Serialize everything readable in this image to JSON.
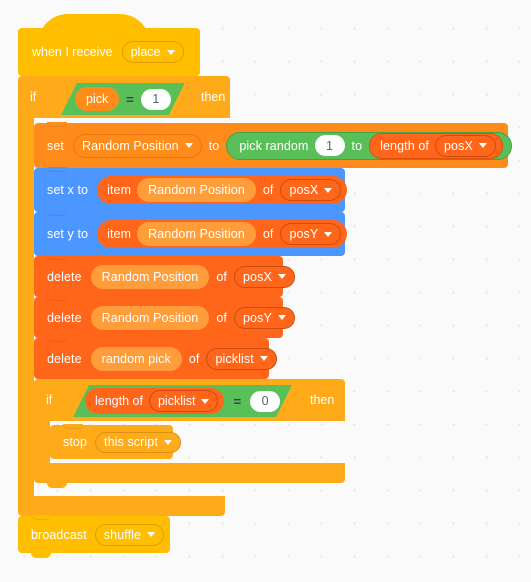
{
  "workspace": {
    "background_color": "#fafafa",
    "grid_dot_color": "#e3e3e3"
  },
  "palette": {
    "events": "#ffbf00",
    "control": "#ffab19",
    "motion": "#4c97ff",
    "variables": "#ff8c1a",
    "lists": "#ff661a",
    "operators": "#59c059",
    "input_text": "#575e75"
  },
  "script": {
    "hat": {
      "label": "when I receive",
      "dropdown_value": "place",
      "dropdown_icon": "chevron-down-icon"
    },
    "if_outer": {
      "label": "if",
      "then_label": "then",
      "condition": {
        "left_operand": "pick",
        "operator": "=",
        "right_operand": "1"
      }
    },
    "set_variable": {
      "label": "set",
      "variable": "Random Position",
      "to_label": "to",
      "dropdown_icon": "chevron-down-icon",
      "value": {
        "label": "pick random",
        "from": "1",
        "to_label": "to",
        "length_of_label": "length of",
        "list": "posX",
        "dropdown_icon": "chevron-down-icon"
      }
    },
    "set_x": {
      "label": "set x to",
      "item_label": "item",
      "index": "Random Position",
      "of_label": "of",
      "list": "posX",
      "dropdown_icon": "chevron-down-icon"
    },
    "set_y": {
      "label": "set y to",
      "item_label": "item",
      "index": "Random Position",
      "of_label": "of",
      "list": "posY",
      "dropdown_icon": "chevron-down-icon"
    },
    "delete_1": {
      "label": "delete",
      "index": "Random Position",
      "of_label": "of",
      "list": "posX",
      "dropdown_icon": "chevron-down-icon"
    },
    "delete_2": {
      "label": "delete",
      "index": "Random Position",
      "of_label": "of",
      "list": "posY",
      "dropdown_icon": "chevron-down-icon"
    },
    "delete_3": {
      "label": "delete",
      "index": "random pick",
      "of_label": "of",
      "list": "picklist",
      "dropdown_icon": "chevron-down-icon"
    },
    "if_inner": {
      "label": "if",
      "then_label": "then",
      "condition": {
        "length_of_label": "length of",
        "list": "picklist",
        "dropdown_icon": "chevron-down-icon",
        "operator": "=",
        "right_operand": "0"
      }
    },
    "stop": {
      "label": "stop",
      "dropdown_value": "this script",
      "dropdown_icon": "chevron-down-icon"
    },
    "broadcast": {
      "label": "broadcast",
      "dropdown_value": "shuffle",
      "dropdown_icon": "chevron-down-icon"
    }
  }
}
